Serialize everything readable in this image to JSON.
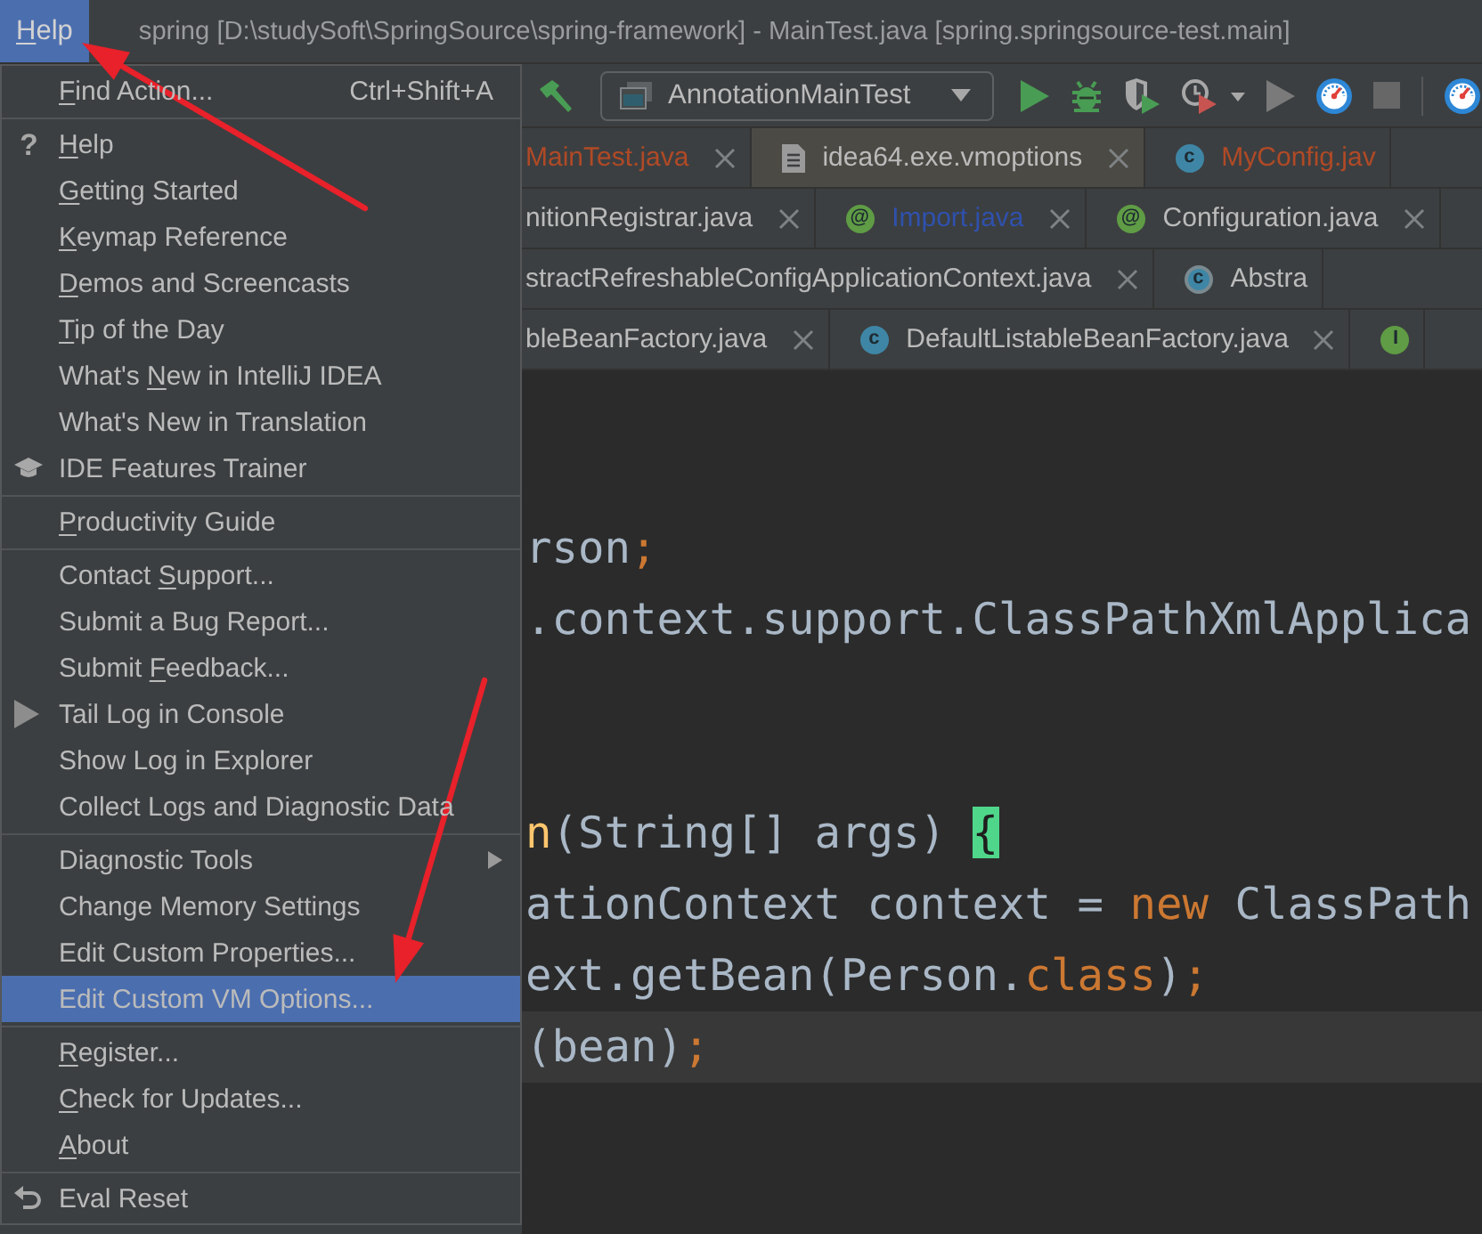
{
  "title_bar": {
    "menu": {
      "label": [
        {
          "text": "H",
          "underlined": true
        },
        {
          "text": "elp",
          "underlined": false
        }
      ],
      "selected": true,
      "arrow": true
    },
    "title": "spring [D:\\studySoft\\SpringSource\\spring-framework] - MainTest.java [spring.springsource-test.main]"
  },
  "menu": {
    "sections": [
      {
        "items": [
          {
            "label": [
              {
                "text": "F",
                "underlined": true
              },
              {
                "text": "ind Action...",
                "underlined": false
              }
            ],
            "shortcut": "Ctrl+Shift+A",
            "kind": "plain",
            "selected": false,
            "arrow": false
          }
        ]
      },
      {
        "items": [
          {
            "label": [
              {
                "text": "H",
                "underlined": true
              },
              {
                "text": "elp",
                "underlined": false
              }
            ],
            "kind": "help",
            "glyph": "?",
            "selected": false,
            "arrow": false
          },
          {
            "label": [
              {
                "text": "G",
                "underlined": true
              },
              {
                "text": "etting Started",
                "underlined": false
              }
            ],
            "kind": "plain",
            "selected": false,
            "arrow": false
          },
          {
            "label": [
              {
                "text": "K",
                "underlined": true
              },
              {
                "text": "eymap Reference",
                "underlined": false
              }
            ],
            "kind": "plain",
            "selected": false,
            "arrow": false
          },
          {
            "label": [
              {
                "text": "D",
                "underlined": true
              },
              {
                "text": "emos and Screencasts",
                "underlined": false
              }
            ],
            "kind": "plain",
            "selected": false,
            "arrow": false
          },
          {
            "label": [
              {
                "text": "T",
                "underlined": true
              },
              {
                "text": "ip of the Day",
                "underlined": false
              }
            ],
            "kind": "plain",
            "selected": false,
            "arrow": false
          },
          {
            "label": [
              {
                "text": "What's ",
                "underlined": false
              },
              {
                "text": "N",
                "underlined": true
              },
              {
                "text": "ew in IntelliJ IDEA",
                "underlined": false
              }
            ],
            "kind": "plain",
            "selected": false,
            "arrow": false
          },
          {
            "label": [
              {
                "text": "What's New in Translation",
                "underlined": false
              }
            ],
            "kind": "plain",
            "selected": false,
            "arrow": false
          },
          {
            "label": [
              {
                "text": "IDE Features Trainer",
                "underlined": false
              }
            ],
            "kind": "trainer",
            "selected": false,
            "arrow": false
          }
        ]
      },
      {
        "items": [
          {
            "label": [
              {
                "text": "P",
                "underlined": true
              },
              {
                "text": "roductivity Guide",
                "underlined": false
              }
            ],
            "kind": "plain",
            "selected": false,
            "arrow": false
          }
        ]
      },
      {
        "items": [
          {
            "label": [
              {
                "text": "Contact ",
                "underlined": false
              },
              {
                "text": "S",
                "underlined": true
              },
              {
                "text": "upport...",
                "underlined": false
              }
            ],
            "kind": "plain",
            "selected": false,
            "arrow": false
          },
          {
            "label": [
              {
                "text": "Submit a Bug Report...",
                "underlined": false
              }
            ],
            "kind": "plain",
            "selected": false,
            "arrow": false
          },
          {
            "label": [
              {
                "text": "Submit ",
                "underlined": false
              },
              {
                "text": "F",
                "underlined": true
              },
              {
                "text": "eedback...",
                "underlined": false
              }
            ],
            "kind": "plain",
            "selected": false,
            "arrow": false
          },
          {
            "label": [
              {
                "text": "Tail Log in Console",
                "underlined": false
              }
            ],
            "kind": "tail",
            "selected": false,
            "arrow": false
          },
          {
            "label": [
              {
                "text": "Show Log in Explorer",
                "underlined": false
              }
            ],
            "kind": "plain",
            "selected": false,
            "arrow": false
          },
          {
            "label": [
              {
                "text": "Collect Logs and Diagnostic Data",
                "underlined": false
              }
            ],
            "kind": "plain",
            "selected": false,
            "arrow": false
          }
        ]
      },
      {
        "items": [
          {
            "label": [
              {
                "text": "Diagnostic Tools",
                "underlined": false
              }
            ],
            "kind": "submenu",
            "selected": false,
            "arrow": false
          },
          {
            "label": [
              {
                "text": "Change Memory Settings",
                "underlined": false
              }
            ],
            "kind": "plain",
            "selected": false,
            "arrow": false
          },
          {
            "label": [
              {
                "text": "Edit Custom Properties...",
                "underlined": false
              }
            ],
            "kind": "plain",
            "selected": false,
            "arrow": false
          },
          {
            "label": [
              {
                "text": "Edit Custom VM Options...",
                "underlined": false
              }
            ],
            "kind": "plain",
            "selected": true,
            "arrow": true
          }
        ]
      },
      {
        "items": [
          {
            "label": [
              {
                "text": "R",
                "underlined": true
              },
              {
                "text": "egister...",
                "underlined": false
              }
            ],
            "kind": "plain",
            "selected": false,
            "arrow": false
          },
          {
            "label": [
              {
                "text": "C",
                "underlined": true
              },
              {
                "text": "heck for Updates...",
                "underlined": false
              }
            ],
            "kind": "plain",
            "selected": false,
            "arrow": false
          },
          {
            "label": [
              {
                "text": "A",
                "underlined": true
              },
              {
                "text": "bout",
                "underlined": false
              }
            ],
            "kind": "plain",
            "selected": false,
            "arrow": false
          }
        ]
      },
      {
        "items": [
          {
            "label": [
              {
                "text": "Eval Reset",
                "underlined": false
              }
            ],
            "kind": "reset",
            "selected": false,
            "arrow": false
          }
        ]
      }
    ]
  },
  "toolbar": {
    "items": [
      {
        "kind": "build",
        "disabled": false
      },
      {
        "kind": "runconfig",
        "value": "AnnotationMainTest"
      },
      {
        "kind": "run",
        "disabled": false
      },
      {
        "kind": "debug",
        "disabled": false
      },
      {
        "kind": "coverage",
        "disabled": false
      },
      {
        "kind": "profile",
        "disabled": false
      },
      {
        "kind": "run",
        "disabled": true
      },
      {
        "kind": "gauge",
        "disabled": false
      },
      {
        "kind": "stop",
        "disabled": true
      },
      {
        "kind": "separator"
      },
      {
        "kind": "gauge",
        "disabled": false
      }
    ]
  },
  "tab_rows": [
    {
      "tabs": [
        {
          "label": "MainTest.java",
          "kind": "plain",
          "color": "#b04a26",
          "selected": false,
          "closable": true
        },
        {
          "label": "idea64.exe.vmoptions",
          "kind": "file",
          "color": "#bbbbbb",
          "selected": true,
          "closable": true
        },
        {
          "label": "MyConfig.jav",
          "kind": "class",
          "badge": "c",
          "color": "#b04a26",
          "selected": false,
          "closable": false
        }
      ]
    },
    {
      "tabs": [
        {
          "label": "nitionRegistrar.java",
          "kind": "plain",
          "color": "#bbbbbb",
          "selected": false,
          "closable": true
        },
        {
          "label": "Import.java",
          "kind": "annotation",
          "badge": "@",
          "color": "#2f51ad",
          "selected": false,
          "closable": true
        },
        {
          "label": "Configuration.java",
          "kind": "annotation",
          "badge": "@",
          "color": "#bbbbbb",
          "selected": false,
          "closable": true
        }
      ]
    },
    {
      "tabs": [
        {
          "label": "stractRefreshableConfigApplicationContext.java",
          "kind": "plain",
          "color": "#bbbbbb",
          "selected": false,
          "closable": true
        },
        {
          "label": "Abstra",
          "kind": "abstract",
          "badge": "c",
          "color": "#bbbbbb",
          "selected": false,
          "closable": false
        }
      ]
    },
    {
      "tabs": [
        {
          "label": "bleBeanFactory.java",
          "kind": "plain",
          "color": "#bbbbbb",
          "selected": false,
          "closable": true
        },
        {
          "label": "DefaultListableBeanFactory.java",
          "kind": "class",
          "badge": "c",
          "color": "#bbbbbb",
          "selected": false,
          "closable": true
        },
        {
          "kind": "interface",
          "badge": "I",
          "selected": false,
          "closable": false
        }
      ]
    }
  ],
  "editor": {
    "lines": [
      {
        "current": false
      },
      {
        "current": false
      },
      {
        "tokens": [
          {
            "text": "rson",
            "kind": "plain"
          },
          {
            "text": ";",
            "kind": "keyword"
          }
        ],
        "current": false
      },
      {
        "tokens": [
          {
            "text": ".context.support.ClassPathXmlApplica",
            "kind": "plain"
          }
        ],
        "current": false
      },
      {
        "current": false
      },
      {
        "current": false
      },
      {
        "tokens": [
          {
            "text": "n",
            "kind": "method"
          },
          {
            "text": "(String[] args) ",
            "kind": "plain"
          },
          {
            "text": "{",
            "kind": "brace"
          }
        ],
        "current": false
      },
      {
        "tokens": [
          {
            "text": "ationContext context = ",
            "kind": "plain"
          },
          {
            "text": "new",
            "kind": "keyword"
          },
          {
            "text": " ClassPath",
            "kind": "plain"
          }
        ],
        "current": false
      },
      {
        "tokens": [
          {
            "text": "ext.getBean(Person.",
            "kind": "plain"
          },
          {
            "text": "class",
            "kind": "keyword"
          },
          {
            "text": ")",
            "kind": "plain"
          },
          {
            "text": ";",
            "kind": "keyword"
          }
        ],
        "current": false
      },
      {
        "tokens": [
          {
            "text": "(bean)",
            "kind": "plain"
          },
          {
            "text": ";",
            "kind": "keyword"
          }
        ],
        "current": true
      },
      {
        "current": false
      },
      {
        "current": false
      }
    ]
  }
}
